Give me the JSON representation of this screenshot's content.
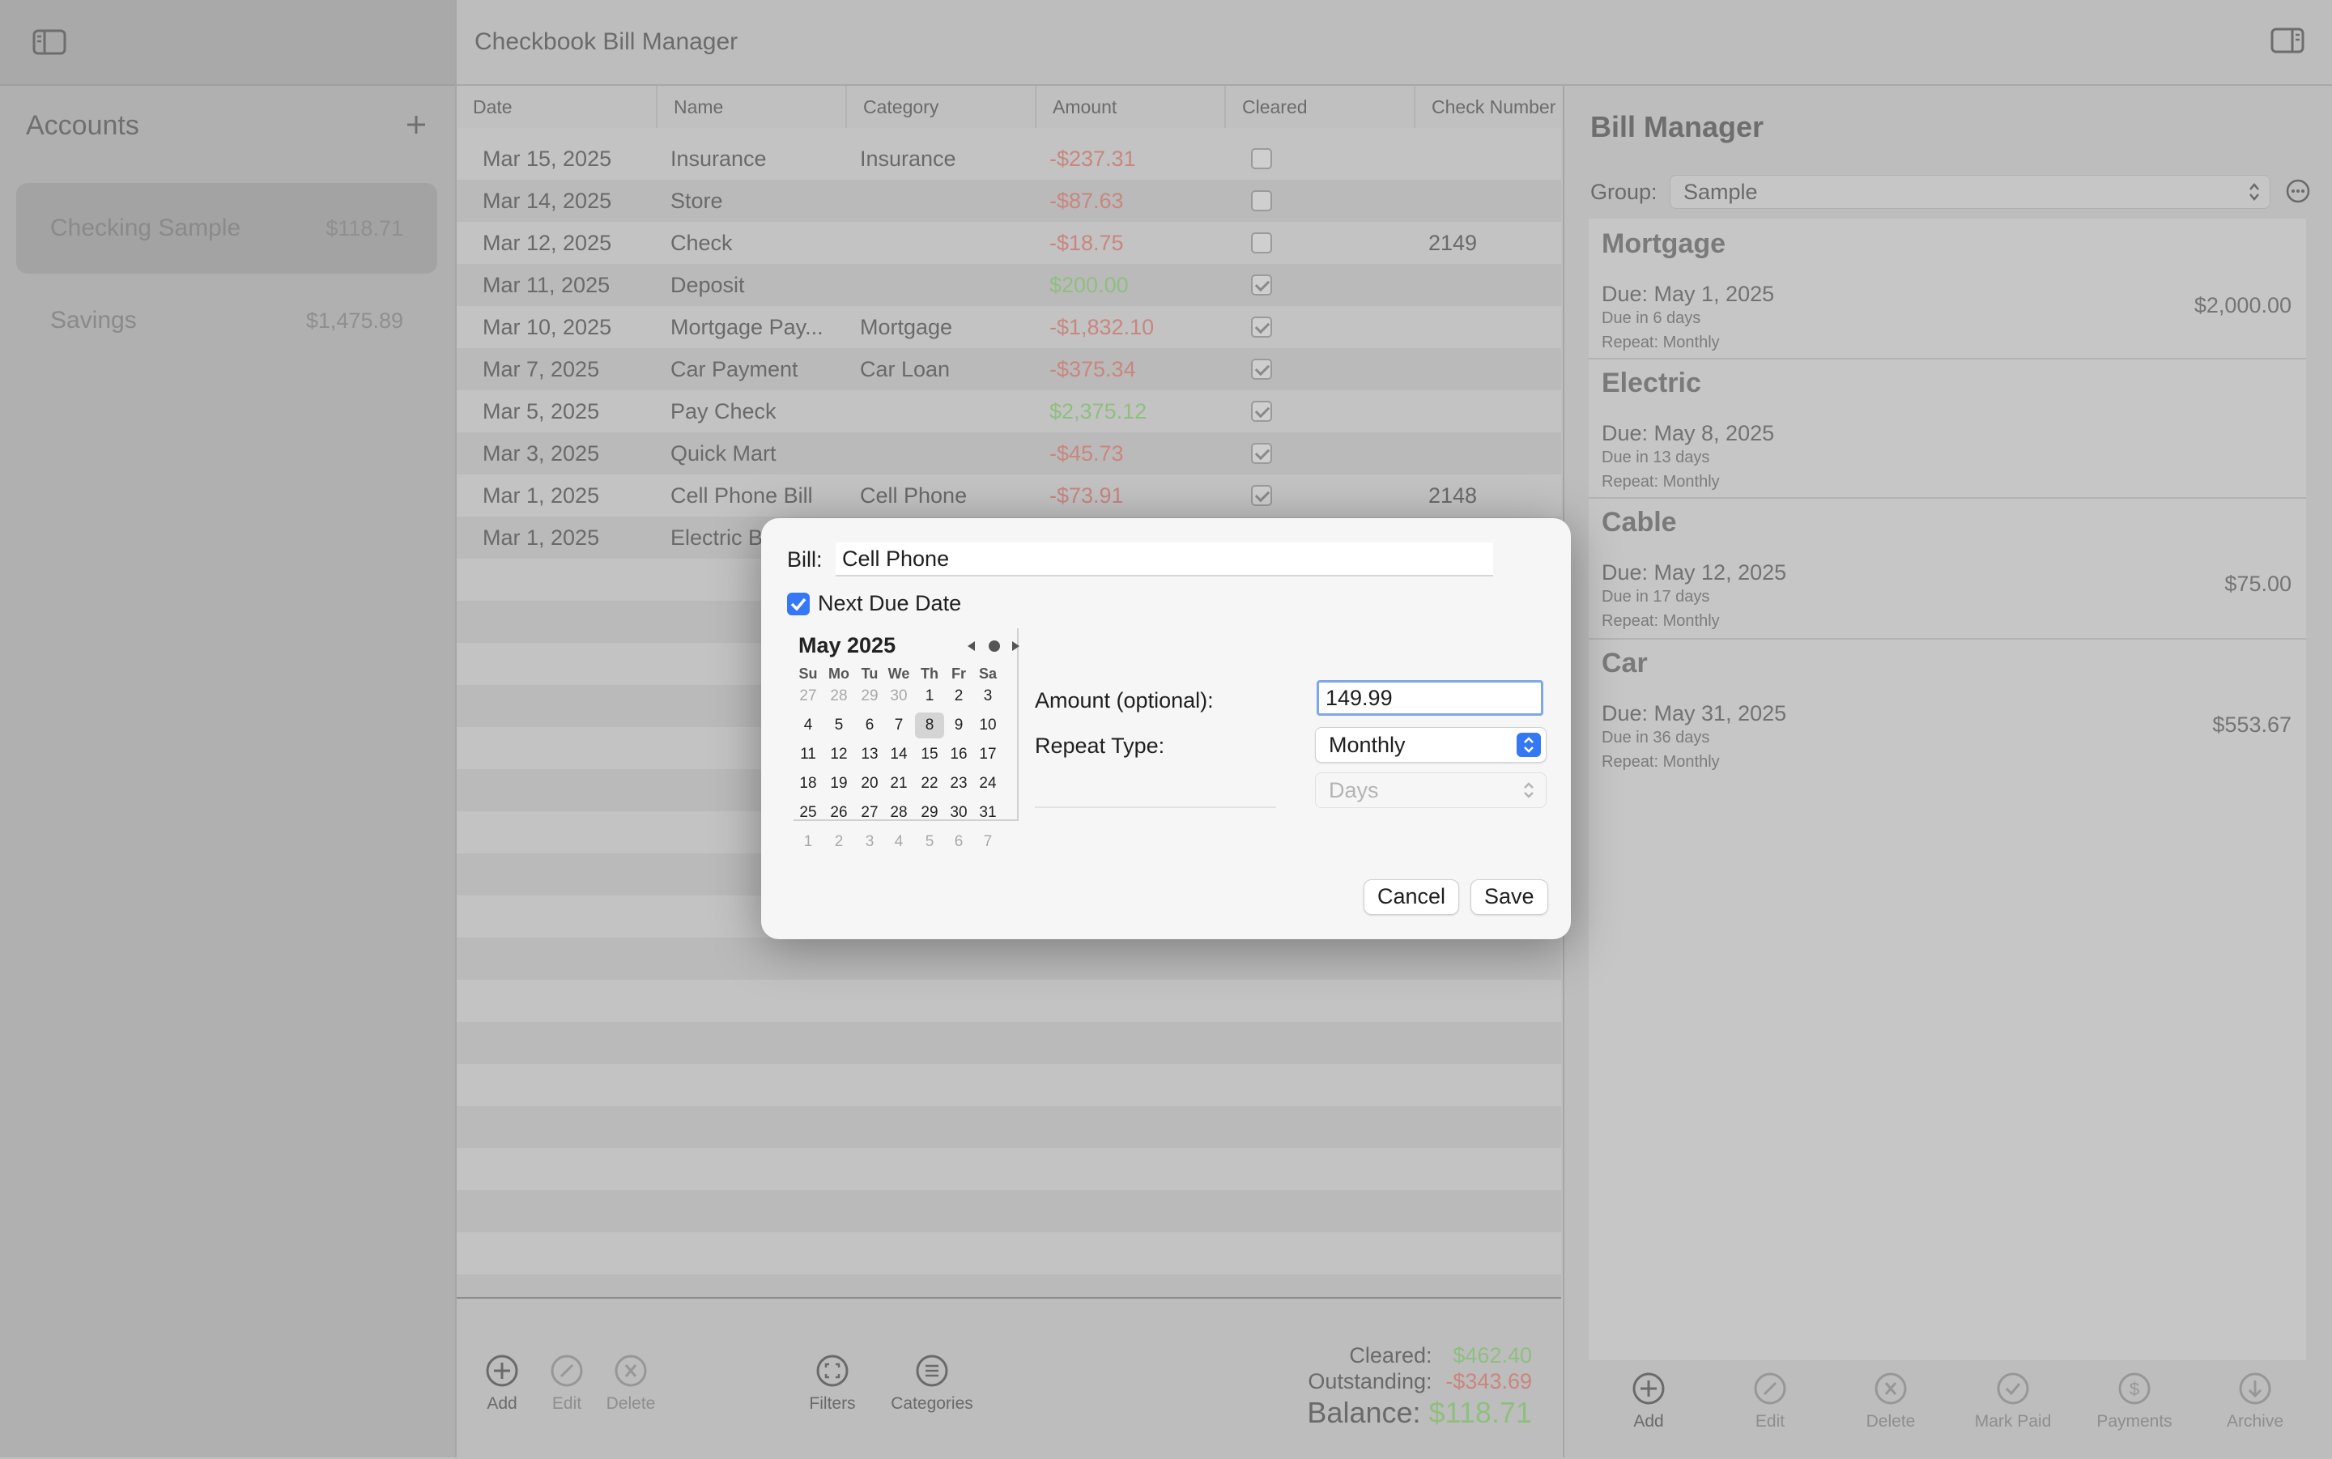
{
  "window": {
    "title": "Checkbook Bill Manager"
  },
  "sidebar": {
    "heading": "Accounts",
    "accounts": [
      {
        "name": "Checking Sample",
        "balance": "$118.71"
      },
      {
        "name": "Savings",
        "balance": "$1,475.89"
      }
    ]
  },
  "table": {
    "columns": [
      "Date",
      "Name",
      "Category",
      "Amount",
      "Cleared",
      "Check Number"
    ],
    "rows": [
      {
        "date": "Mar 15, 2025",
        "name": "Insurance",
        "category": "Insurance",
        "amount": "-$237.31",
        "cleared": false,
        "check": ""
      },
      {
        "date": "Mar 14, 2025",
        "name": "Store",
        "category": "",
        "amount": "-$87.63",
        "cleared": false,
        "check": ""
      },
      {
        "date": "Mar 12, 2025",
        "name": "Check",
        "category": "",
        "amount": "-$18.75",
        "cleared": false,
        "check": "2149"
      },
      {
        "date": "Mar 11, 2025",
        "name": "Deposit",
        "category": "",
        "amount": "$200.00",
        "cleared": true,
        "check": ""
      },
      {
        "date": "Mar 10, 2025",
        "name": "Mortgage Pay...",
        "category": "Mortgage",
        "amount": "-$1,832.10",
        "cleared": true,
        "check": ""
      },
      {
        "date": "Mar 7, 2025",
        "name": "Car Payment",
        "category": "Car Loan",
        "amount": "-$375.34",
        "cleared": true,
        "check": ""
      },
      {
        "date": "Mar 5, 2025",
        "name": "Pay Check",
        "category": "",
        "amount": "$2,375.12",
        "cleared": true,
        "check": ""
      },
      {
        "date": "Mar 3, 2025",
        "name": "Quick Mart",
        "category": "",
        "amount": "-$45.73",
        "cleared": true,
        "check": ""
      },
      {
        "date": "Mar 1, 2025",
        "name": "Cell Phone Bill",
        "category": "Cell Phone",
        "amount": "-$73.91",
        "cleared": true,
        "check": "2148"
      },
      {
        "date": "Mar 1, 2025",
        "name": "Electric B",
        "category": "",
        "amount": "",
        "cleared": false,
        "check": ""
      }
    ]
  },
  "toolbar": {
    "add": "Add",
    "edit": "Edit",
    "delete": "Delete",
    "filters": "Filters",
    "categories": "Categories"
  },
  "totals": {
    "cleared_label": "Cleared:",
    "cleared_value": "$462.40",
    "outstanding_label": "Outstanding:",
    "outstanding_value": "-$343.69",
    "balance_label": "Balance:",
    "balance_value": "$118.71"
  },
  "bill_manager": {
    "title": "Bill Manager",
    "group_label": "Group:",
    "group_value": "Sample",
    "bills": [
      {
        "name": "Mortgage",
        "due": "Due: May 1, 2025",
        "due_in": "Due in 6 days",
        "repeat": "Repeat: Monthly",
        "amount": "$2,000.00"
      },
      {
        "name": "Electric",
        "due": "Due: May 8, 2025",
        "due_in": "Due in 13 days",
        "repeat": "Repeat: Monthly",
        "amount": ""
      },
      {
        "name": "Cable",
        "due": "Due: May 12, 2025",
        "due_in": "Due in 17 days",
        "repeat": "Repeat: Monthly",
        "amount": "$75.00"
      },
      {
        "name": "Car",
        "due": "Due: May 31, 2025",
        "due_in": "Due in 36 days",
        "repeat": "Repeat: Monthly",
        "amount": "$553.67"
      }
    ],
    "toolbar": {
      "add": "Add",
      "edit": "Edit",
      "delete": "Delete",
      "mark_paid": "Mark Paid",
      "payments": "Payments",
      "archive": "Archive"
    }
  },
  "dialog": {
    "bill_label": "Bill:",
    "bill_value": "Cell Phone",
    "next_due_label": "Next Due Date",
    "next_due_checked": true,
    "calendar": {
      "month": "May 2025",
      "weekdays": [
        "Su",
        "Mo",
        "Tu",
        "We",
        "Th",
        "Fr",
        "Sa"
      ],
      "weeks": [
        [
          "27",
          "28",
          "29",
          "30",
          "1",
          "2",
          "3"
        ],
        [
          "4",
          "5",
          "6",
          "7",
          "8",
          "9",
          "10"
        ],
        [
          "11",
          "12",
          "13",
          "14",
          "15",
          "16",
          "17"
        ],
        [
          "18",
          "19",
          "20",
          "21",
          "22",
          "23",
          "24"
        ],
        [
          "25",
          "26",
          "27",
          "28",
          "29",
          "30",
          "31"
        ],
        [
          "1",
          "2",
          "3",
          "4",
          "5",
          "6",
          "7"
        ]
      ],
      "selected": "8"
    },
    "amount_label": "Amount (optional):",
    "amount_value": "149.99",
    "repeat_label": "Repeat Type:",
    "repeat_value": "Monthly",
    "days_placeholder": "Days",
    "cancel": "Cancel",
    "save": "Save"
  },
  "colors": {
    "accent": "#3478f6",
    "negative": "#c9867f",
    "positive": "#8fbf7f"
  }
}
